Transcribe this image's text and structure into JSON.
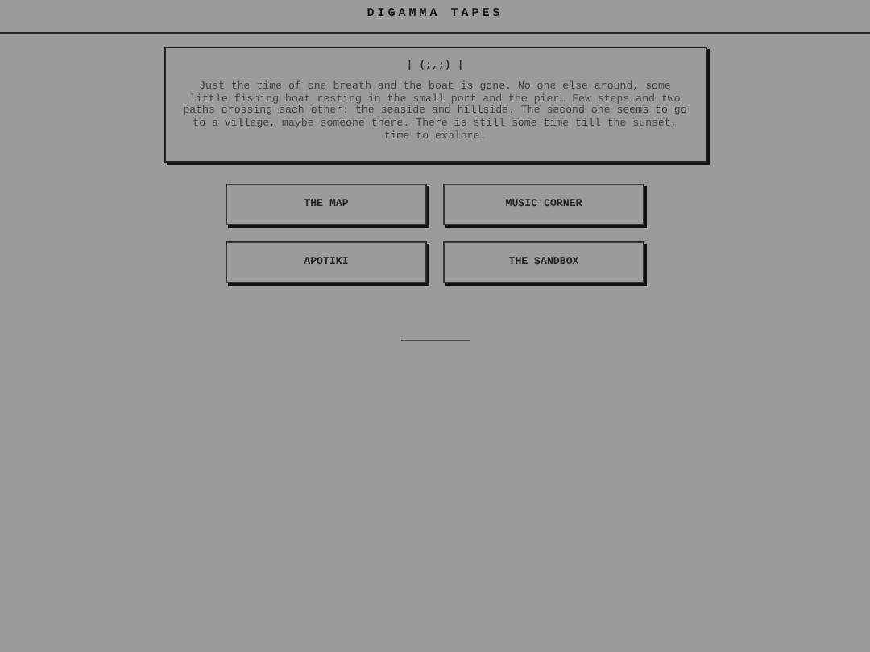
{
  "header": {
    "title": "DIGAMMA TAPES"
  },
  "intro": {
    "emoticon": "| (;,;) |",
    "text": "Just the time of one breath and the boat is gone. No one else around, some little fishing boat resting in the small port and the pier… Few steps and two paths crossing each other: the seaside and hillside. The second one seems to go to a village, maybe someone there. There is still some time till the sunset, time to explore."
  },
  "menu": [
    {
      "label": "THE MAP"
    },
    {
      "label": "MUSIC CORNER"
    },
    {
      "label": "APOTIKI"
    },
    {
      "label": "THE SANDBOX"
    }
  ]
}
